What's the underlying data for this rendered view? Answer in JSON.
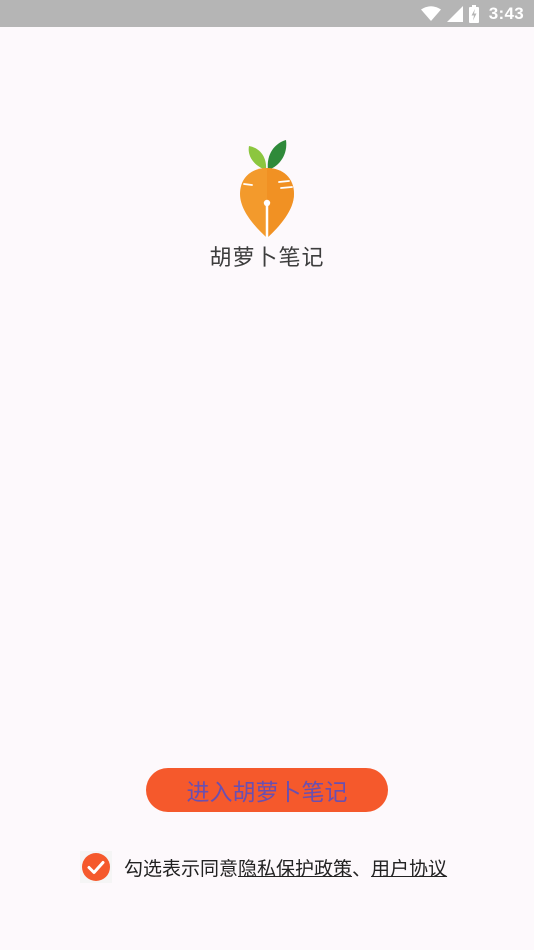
{
  "status_bar": {
    "time": "3:43"
  },
  "app": {
    "name": "胡萝卜笔记"
  },
  "main": {
    "enter_button_label": "进入胡萝卜笔记"
  },
  "agreement": {
    "checked": true,
    "prefix_text": "勾选表示同意",
    "privacy_link": "隐私保护政策",
    "separator": "、",
    "terms_link": "用户协议"
  },
  "colors": {
    "accent": "#f5592c",
    "button_text": "#6a4fb0",
    "status_bar": "#b5b5b5",
    "background": "#fdf9fc"
  },
  "icons": {
    "status": [
      "wifi-icon",
      "signal-icon",
      "battery-icon"
    ],
    "logo": "carrot-pen-logo-icon",
    "checkbox": "check-icon"
  }
}
